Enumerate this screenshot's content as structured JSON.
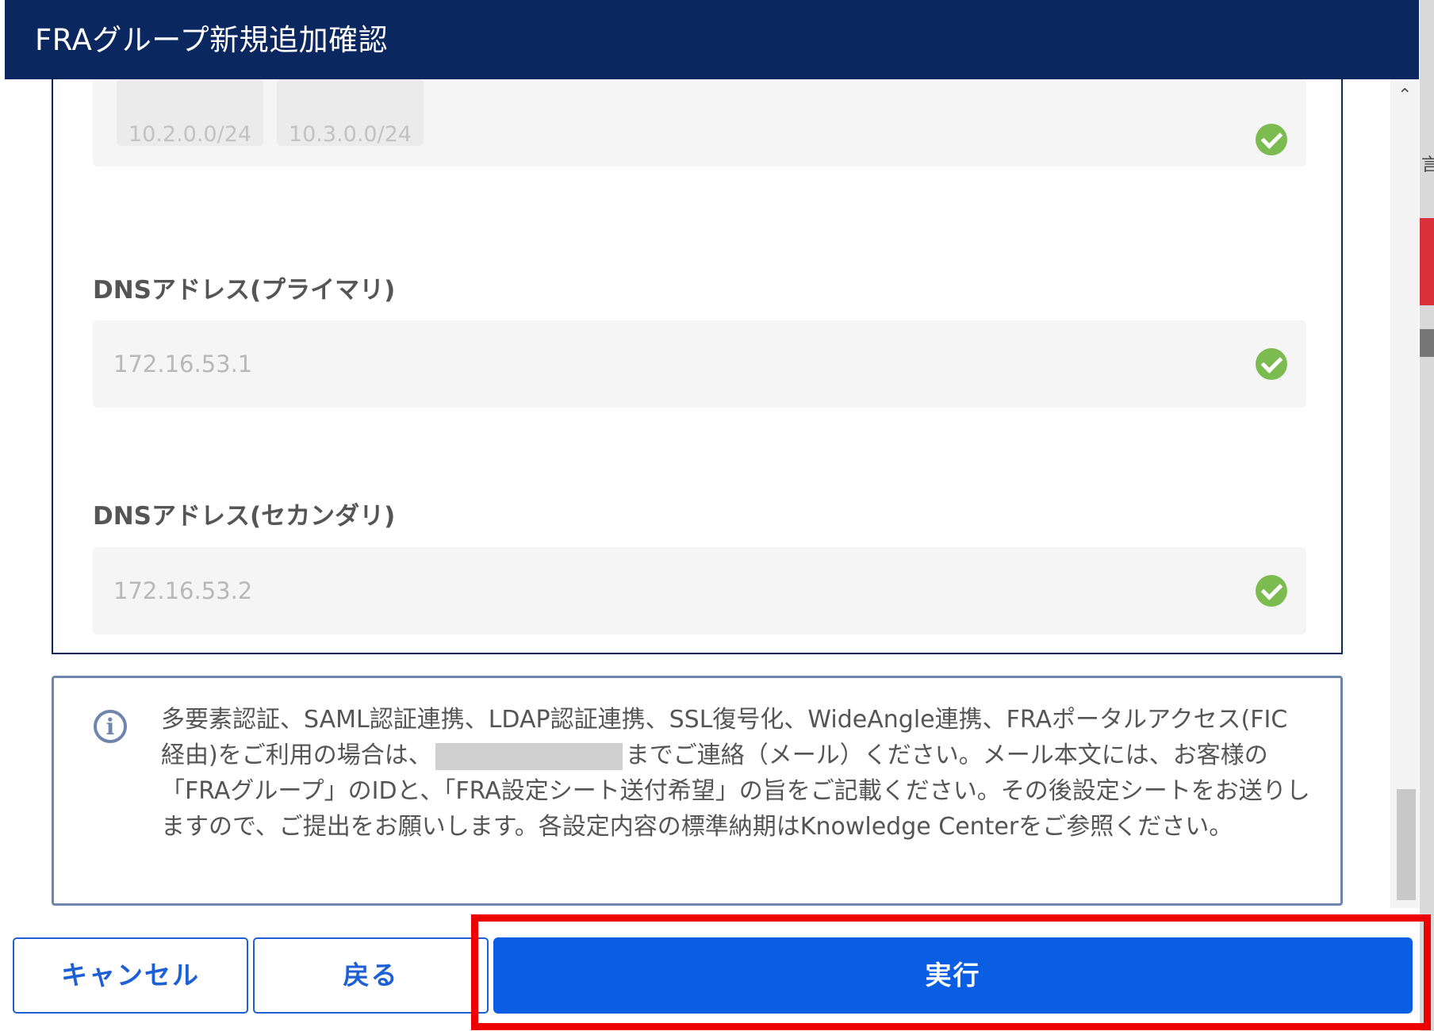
{
  "dialog": {
    "title": "FRAグループ新規追加確認"
  },
  "form": {
    "subnet_chips": [
      "10.2.0.0/24",
      "10.3.0.0/24"
    ],
    "dns_primary": {
      "label": "DNSアドレス(プライマリ)",
      "value": "172.16.53.1"
    },
    "dns_secondary": {
      "label": "DNSアドレス(セカンダリ)",
      "value": "172.16.53.2"
    }
  },
  "notice": {
    "text_before": "多要素認証、SAML認証連携、LDAP認証連携、SSL復号化、WideAngle連携、FRAポータルアクセス(FIC経由)をご利用の場合は、",
    "text_after": "までご連絡（メール）ください。メール本文には、お客様の「FRAグループ」のIDと、「FRA設定シート送付希望」の旨をご記載ください。その後設定シートをお送りしますので、ご提出をお願いします。各設定内容の標準納期はKnowledge Centerをご参照ください。"
  },
  "footer": {
    "cancel_label": "キャンセル",
    "back_label": "戻る",
    "execute_label": "実行"
  },
  "colors": {
    "header_bg": "#0b2760",
    "primary": "#0b5de3",
    "success": "#7cbb4f",
    "highlight": "#ee0000"
  }
}
